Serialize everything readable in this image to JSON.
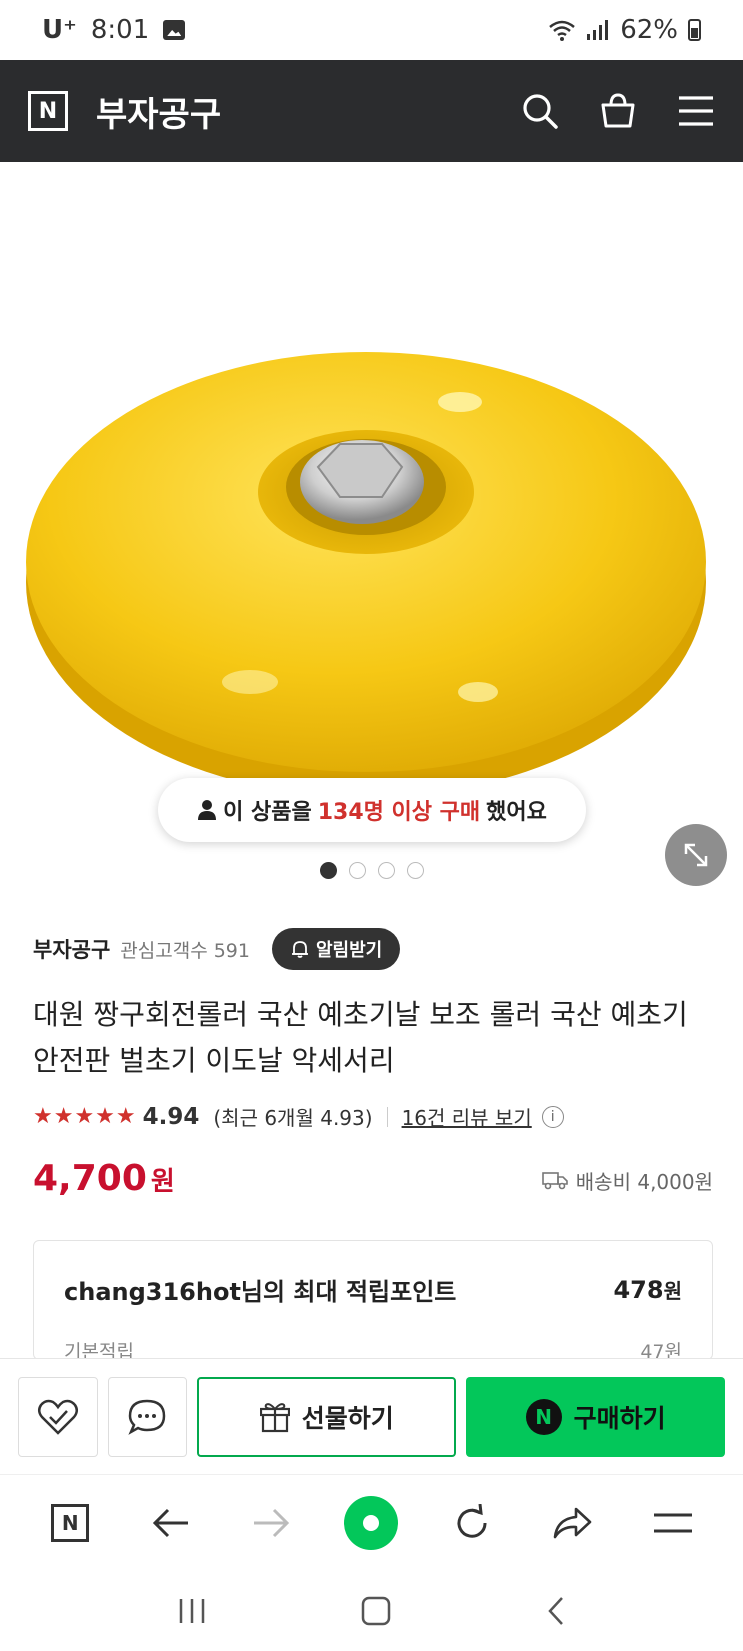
{
  "status_bar": {
    "carrier": "U⁺",
    "time": "8:01",
    "battery": "62%"
  },
  "header": {
    "logo": "N",
    "title": "부자공구"
  },
  "product_image": {
    "description_alt": "yellow roller"
  },
  "buy_badge": {
    "prefix": "이 상품을",
    "highlight": "134명 이상 구매",
    "suffix": "했어요"
  },
  "carousel": {
    "count": 4,
    "active": 0
  },
  "store": {
    "name": "부자공구",
    "fans": "관심고객수 591",
    "alarm_label": "알림받기"
  },
  "product": {
    "title": "대원 짱구회전롤러 국산 예초기날 보조 롤러 국산 예초기안전판 벌초기 이도날 악세서리"
  },
  "rating": {
    "stars": "★★★★★",
    "score": "4.94",
    "recent": "(최근 6개월 4.93)",
    "review_link": "16건 리뷰 보기",
    "info": "i"
  },
  "price": {
    "amount": "4,700",
    "unit": "원",
    "shipping": "배송비 4,000원"
  },
  "points": {
    "label": "chang316hot님의 최대 적립포인트",
    "value": "478",
    "unit": "원",
    "sub_label": "기본적립",
    "sub_value": "47원"
  },
  "actions": {
    "gift_label": "선물하기",
    "buy_label": "구매하기",
    "npay": "N"
  },
  "browser_bar": {
    "home": "N"
  },
  "colors": {
    "accent_green": "#03c75a",
    "price_red": "#c8102e",
    "header_dark": "#2b2c2e"
  }
}
